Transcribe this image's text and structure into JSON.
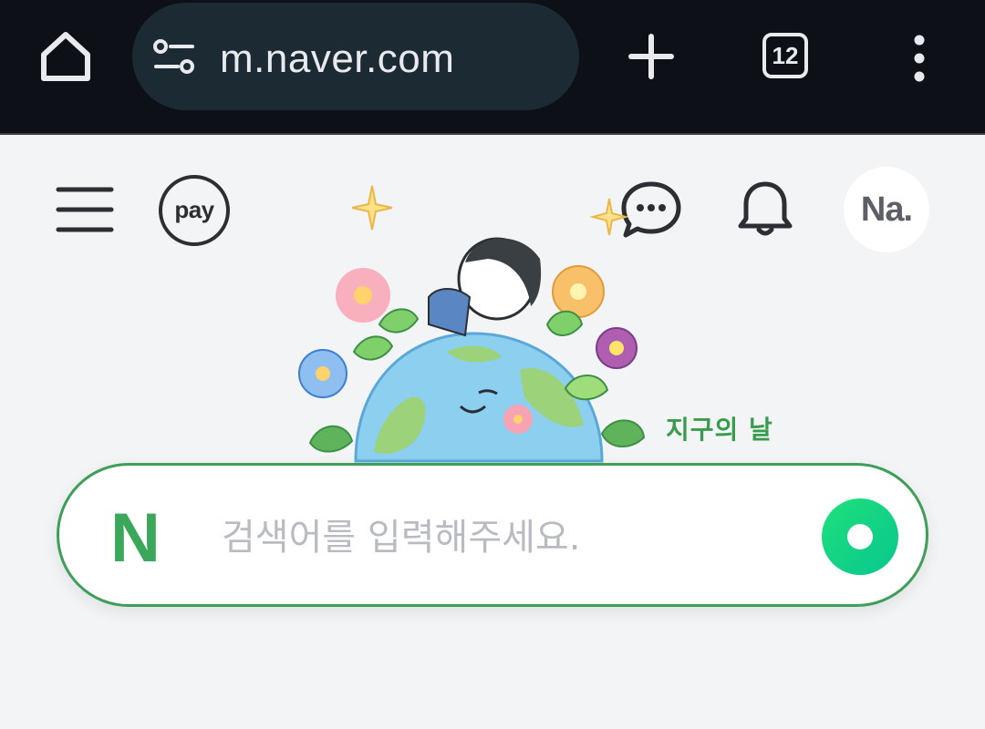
{
  "browser": {
    "url": "m.naver.com",
    "tab_count": "12",
    "icons": {
      "home": "home-icon",
      "site_info": "tune-icon",
      "new_tab": "plus-icon",
      "tabs": "tabs-icon",
      "menu": "more-vert-icon"
    }
  },
  "header": {
    "pay_label": "pay",
    "avatar_label": "Na.",
    "icons": [
      "hamburger-icon",
      "chat-icon",
      "bell-icon"
    ]
  },
  "doodle": {
    "caption": "지구의 날"
  },
  "search": {
    "logo": "N",
    "placeholder": "검색어를 입력해주세요.",
    "value": ""
  },
  "colors": {
    "browser_bg": "#0d1117",
    "url_pill_bg": "#1c2a33",
    "page_bg": "#f3f4f6",
    "brand_green": "#3aa75a",
    "search_border": "#3e9e5a",
    "search_button": "#1fe07a"
  }
}
